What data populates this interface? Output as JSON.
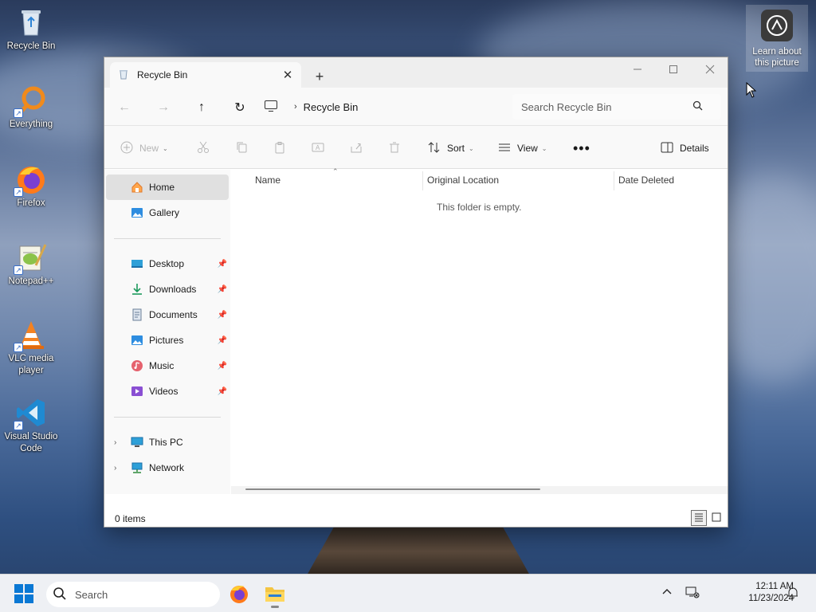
{
  "desktop": {
    "icons": [
      {
        "label": "Recycle Bin",
        "icon": "recycle-bin-icon"
      },
      {
        "label": "Everything",
        "icon": "everything-search-icon"
      },
      {
        "label": "Firefox",
        "icon": "firefox-icon"
      },
      {
        "label": "Notepad++",
        "icon": "notepad-plus-plus-icon"
      },
      {
        "label": "VLC media player",
        "icon": "vlc-icon"
      },
      {
        "label": "Visual Studio Code",
        "icon": "vscode-icon"
      }
    ],
    "learn_about_picture": "Learn about this picture"
  },
  "window": {
    "tab_title": "Recycle Bin",
    "address": {
      "location": "Recycle Bin"
    },
    "search": {
      "placeholder": "Search Recycle Bin"
    },
    "commands": {
      "new": "New",
      "sort": "Sort",
      "view": "View",
      "details": "Details"
    },
    "sidebar": {
      "top": [
        {
          "label": "Home",
          "icon": "home-icon",
          "selected": true
        },
        {
          "label": "Gallery",
          "icon": "gallery-icon"
        }
      ],
      "pinned": [
        {
          "label": "Desktop",
          "icon": "desktop-folder-icon"
        },
        {
          "label": "Downloads",
          "icon": "downloads-icon"
        },
        {
          "label": "Documents",
          "icon": "documents-icon"
        },
        {
          "label": "Pictures",
          "icon": "pictures-icon"
        },
        {
          "label": "Music",
          "icon": "music-icon"
        },
        {
          "label": "Videos",
          "icon": "videos-icon"
        }
      ],
      "bottom": [
        {
          "label": "This PC",
          "icon": "this-pc-icon"
        },
        {
          "label": "Network",
          "icon": "network-icon"
        }
      ]
    },
    "columns": [
      "Name",
      "Original Location",
      "Date Deleted"
    ],
    "empty_message": "This folder is empty.",
    "status": {
      "items": "0 items"
    }
  },
  "taskbar": {
    "search_label": "Search",
    "apps": [
      "firefox-icon",
      "file-explorer-icon"
    ],
    "clock": {
      "time": "12:11 AM",
      "date": "11/23/2024"
    }
  },
  "colors": {
    "accent": "#0a78d4",
    "selection": "#e0e0e0"
  }
}
